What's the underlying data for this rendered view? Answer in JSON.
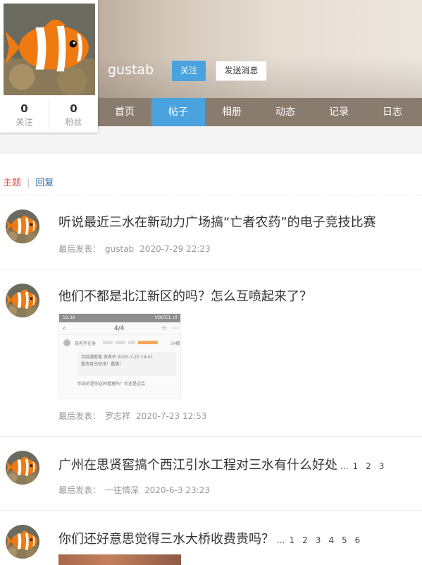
{
  "profile": {
    "username": "gustab",
    "follow_label": "关注",
    "message_label": "发送消息",
    "stats": [
      {
        "num": "0",
        "label": "关注"
      },
      {
        "num": "0",
        "label": "粉丝"
      }
    ]
  },
  "nav": {
    "items": [
      "首页",
      "帖子",
      "相册",
      "动态",
      "记录",
      "日志"
    ],
    "active": "帖子"
  },
  "subtabs": {
    "topic": "主题",
    "reply": "回复",
    "separator": "|"
  },
  "posts": [
    {
      "title": "听说最近三水在新动力广场搞“亡者农药”的电子竞技比赛",
      "meta_prefix": "最后发表：",
      "author": "gustab",
      "date": "2020-7-29 22:23"
    },
    {
      "title": "他们不都是北江新区的吗？怎么互喷起来了？",
      "meta_prefix": "最后发表：",
      "author": "罗志祥",
      "date": "2020-7-23 12:53",
      "thumb": {
        "status_time": "12:36",
        "status_right": "VOLTE1 .ıll",
        "page_counter": "4/4",
        "comment_user": "获有学在身",
        "comment_floor": "34楼",
        "comment_line1": "百姓通看客 发表于 2020-7-22 19:41",
        "comment_line2": "蠢货目光短浅！蠢猪！",
        "comment_line3": "你说的是你这种看猪吗？你还是这会"
      }
    },
    {
      "title": "广州在思贤窖搞个西江引水工程对三水有什么好处",
      "ellipsis": "...",
      "pages": [
        "1",
        "2",
        "3"
      ],
      "meta_prefix": "最后发表：",
      "author": "一往情深",
      "date": "2020-6-3 23:23"
    },
    {
      "title": "你们还好意思觉得三水大桥收费贵吗？",
      "ellipsis": "...",
      "pages": [
        "1",
        "2",
        "3",
        "4",
        "5",
        "6"
      ]
    }
  ],
  "colors": {
    "accent": "#4aa3df",
    "nav_bg": "#8a7b6f",
    "topic_active": "#d9534f",
    "link": "#2a6db0"
  }
}
